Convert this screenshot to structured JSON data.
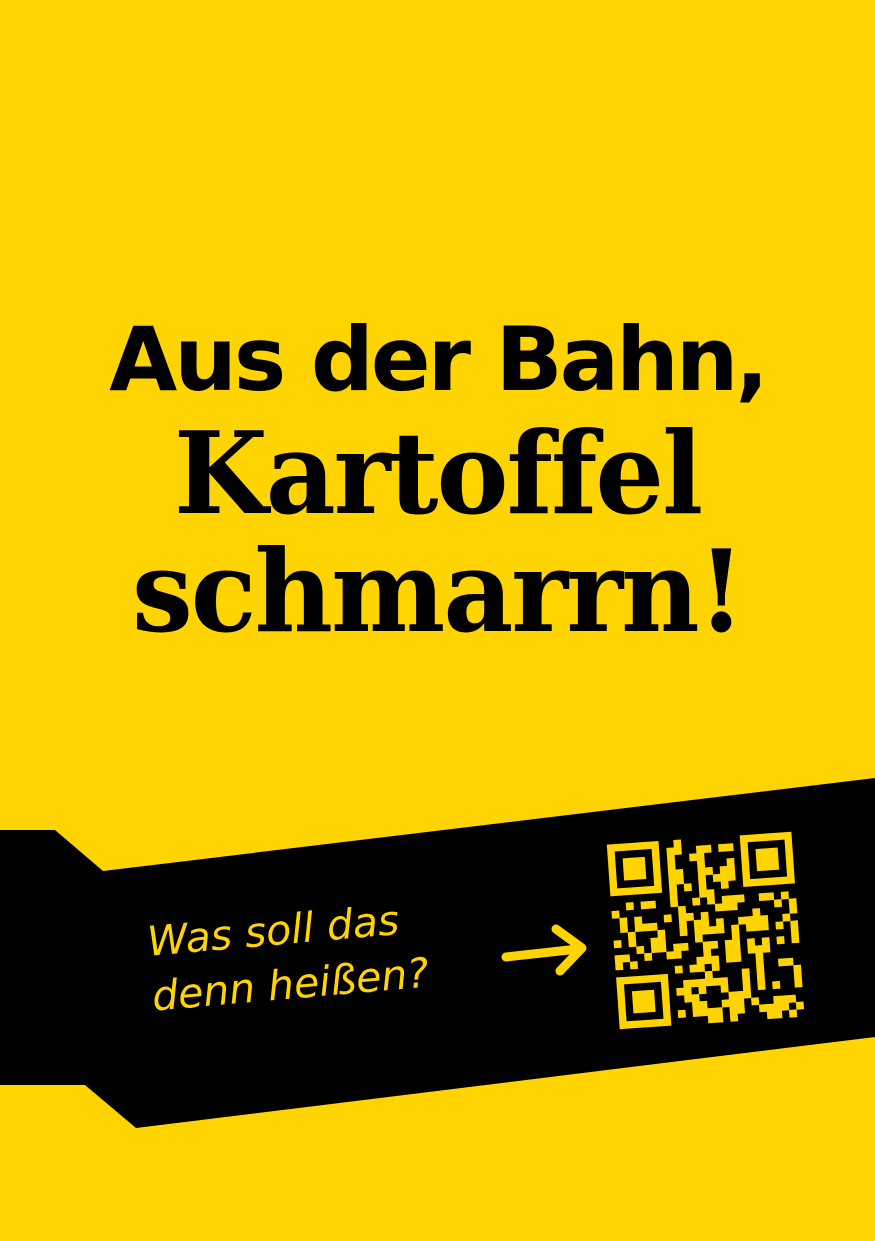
{
  "colors": {
    "background": "#FFD400",
    "banner": "#000000",
    "text_dark": "#000000",
    "text_accent": "#FFD400"
  },
  "headline": {
    "line1": "Aus der Bahn,",
    "line2": "Kartoffel",
    "line3": "schmarrn!"
  },
  "banner": {
    "caption_line1": "Was soll das",
    "caption_line2": "denn heißen?",
    "arrow_icon": "arrow-right-icon",
    "qr_icon": "qr-code-icon"
  }
}
